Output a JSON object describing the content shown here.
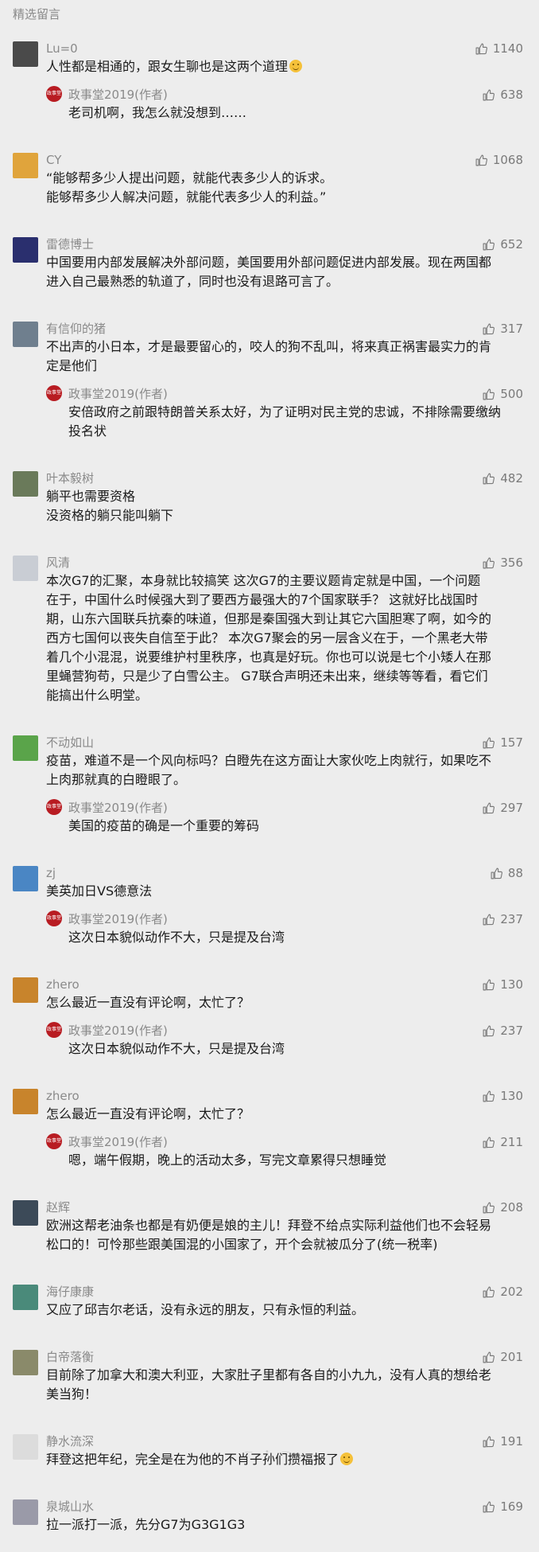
{
  "section_title": "精选留言",
  "comments": [
    {
      "name": "Lu=0",
      "likes": "1140",
      "text": "人性都是相通的，跟女生聊也是这两个道理",
      "has_emoji": true,
      "avatar_color": "#4a4a4a",
      "reply": {
        "name": "政事堂2019(作者)",
        "likes": "638",
        "text": "老司机啊，我怎么就没想到……"
      }
    },
    {
      "name": "CY",
      "likes": "1068",
      "text": "“能够帮多少人提出问题，就能代表多少人的诉求。\n能够帮多少人解决问题，就能代表多少人的利益。”",
      "avatar_color": "#e0a43c"
    },
    {
      "name": "雷德博士",
      "likes": "652",
      "text": "中国要用内部发展解决外部问题，美国要用外部问题促进内部发展。现在两国都进入自己最熟悉的轨道了，同时也没有退路可言了。",
      "avatar_color": "#2a2f6e"
    },
    {
      "name": "有信仰的猪",
      "likes": "317",
      "text": "不出声的小日本，才是最要留心的，咬人的狗不乱叫，将来真正祸害最实力的肯定是他们",
      "avatar_color": "#6f7f8e",
      "reply": {
        "name": "政事堂2019(作者)",
        "likes": "500",
        "text": "安倍政府之前跟特朗普关系太好，为了证明对民主党的忠诚，不排除需要缴纳投名状"
      }
    },
    {
      "name": "叶本毅树",
      "likes": "482",
      "text": "躺平也需要资格\n没资格的躺只能叫躺下",
      "avatar_color": "#6a7a5a"
    },
    {
      "name": "风清",
      "likes": "356",
      "text": "本次G7的汇聚，本身就比较搞笑 这次G7的主要议题肯定就是中国，一个问题在于，中国什么时候强大到了要西方最强大的7个国家联手？ 这就好比战国时期，山东六国联兵抗秦的味道，但那是秦国强大到让其它六国胆寒了啊，如今的西方七国何以丧失自信至于此？ 本次G7聚会的另一层含义在于，一个黑老大带着几个小混混，说要维护村里秩序，也真是好玩。你也可以说是七个小矮人在那里蝇营狗苟，只是少了白雪公主。 G7联合声明还未出来，继续等等看，看它们能搞出什么明堂。",
      "avatar_color": "#c9cdd4"
    },
    {
      "name": "不动如山",
      "likes": "157",
      "text": "疫苗，难道不是一个风向标吗？白瞪先在这方面让大家伙吃上肉就行，如果吃不上肉那就真的白瞪眼了。",
      "avatar_color": "#5aa44a",
      "reply": {
        "name": "政事堂2019(作者)",
        "likes": "297",
        "text": "美国的疫苗的确是一个重要的筹码"
      }
    },
    {
      "name": "zj",
      "likes": "88",
      "text": "美英加日VS德意法",
      "avatar_color": "#4a86c4",
      "reply": {
        "name": "政事堂2019(作者)",
        "likes": "237",
        "text": "这次日本貌似动作不大，只是提及台湾"
      }
    },
    {
      "name": "zhero",
      "likes": "130",
      "text": "怎么最近一直没有评论啊，太忙了？",
      "avatar_color": "#c8842c",
      "reply": {
        "name": "政事堂2019(作者)",
        "likes": "237",
        "text": "这次日本貌似动作不大，只是提及台湾"
      }
    },
    {
      "name": "zhero",
      "likes": "130",
      "text": "怎么最近一直没有评论啊，太忙了？",
      "avatar_color": "#c8842c",
      "reply": {
        "name": "政事堂2019(作者)",
        "likes": "211",
        "text": "嗯，端午假期，晚上的活动太多，写完文章累得只想睡觉"
      }
    },
    {
      "name": "赵辉",
      "likes": "208",
      "text": "欧洲这帮老油条也都是有奶便是娘的主儿！拜登不给点实际利益他们也不会轻易松口的！可怜那些跟美国混的小国家了，开个会就被瓜分了(统一税率)",
      "avatar_color": "#3c4a58"
    },
    {
      "name": "海仔康康",
      "likes": "202",
      "text": "又应了邱吉尔老话，没有永远的朋友，只有永恒的利益。",
      "avatar_color": "#4a8a7a"
    },
    {
      "name": "白帝落衡",
      "likes": "201",
      "text": "目前除了加拿大和澳大利亚，大家肚子里都有各自的小九九，没有人真的想给老美当狗！",
      "avatar_color": "#8a8a6a"
    },
    {
      "name": "静水流深",
      "likes": "191",
      "text": "拜登这把年纪，完全是在为他的不肖子孙们攒福报了",
      "has_emoji": true,
      "avatar_color": "#dcdcdc"
    },
    {
      "name": "泉城山水",
      "likes": "169",
      "text": "拉一派打一派，先分G7为G3G1G3",
      "avatar_color": "#9a9aa8"
    }
  ],
  "reply_avatar_text": "政事堂",
  "bottom_indicator": "— • —"
}
